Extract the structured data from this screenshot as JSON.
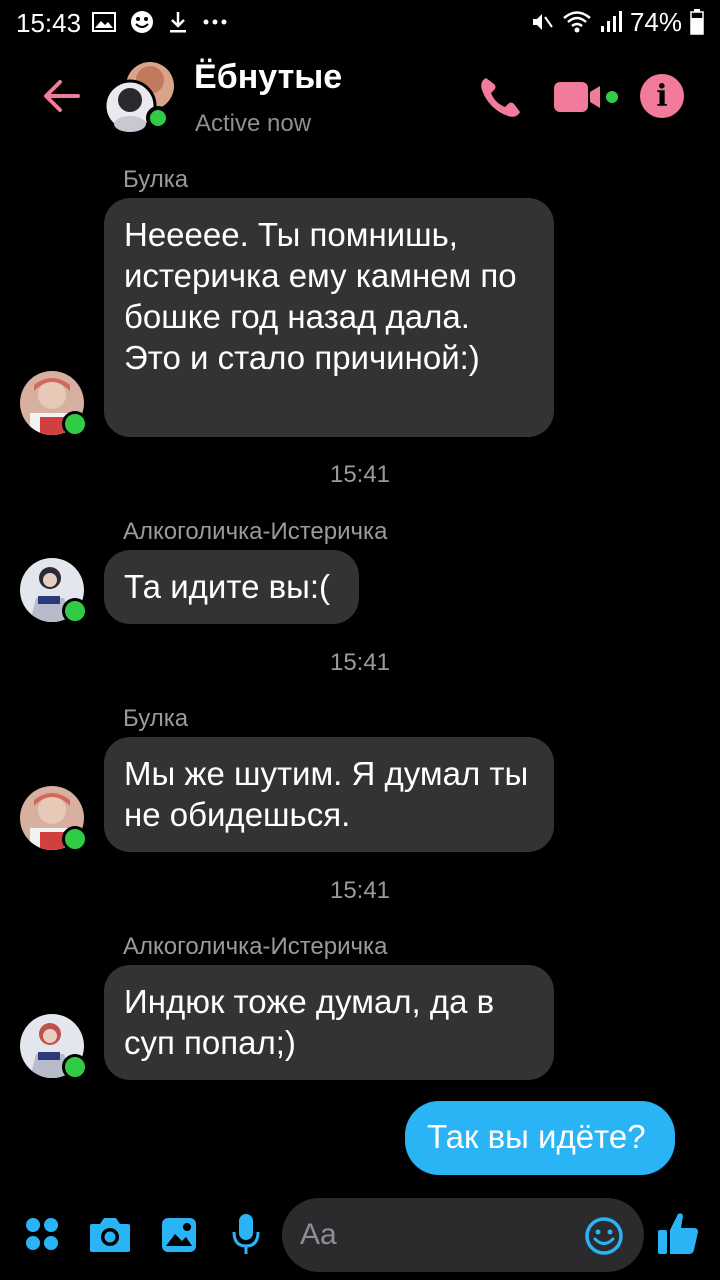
{
  "status_bar": {
    "time": "15:43",
    "battery": "74%",
    "icons_left": [
      "gallery-icon",
      "smiley-icon",
      "download-icon",
      "more-icon"
    ],
    "icons_right": [
      "mute-icon",
      "wifi-icon",
      "signal-icon",
      "battery-icon"
    ]
  },
  "header": {
    "title": "Ёбнутые",
    "subtitle": "Active now",
    "accent_color": "#f27a9a",
    "online_color": "#31cc46"
  },
  "messages": [
    {
      "sender": "Булка",
      "text": "Неееее. Ты помнишь, истеричка ему камнем по бошке год назад дала. Это и стало причиной:)"
    },
    {
      "timestamp": "15:41"
    },
    {
      "sender": "Алкоголичка-Истеричка",
      "text": "Та идите вы:("
    },
    {
      "timestamp": "15:41"
    },
    {
      "sender": "Булка",
      "text": "Мы же шутим. Я думал ты не обидешься."
    },
    {
      "timestamp": "15:41"
    },
    {
      "sender": "Алкоголичка-Истеричка",
      "text": "Индюк тоже думал, да в суп попал;)"
    },
    {
      "own_text": "Так вы идёте?"
    }
  ],
  "composer": {
    "placeholder": "Aa",
    "tools": [
      "apps-icon",
      "camera-icon",
      "gallery-icon",
      "microphone-icon"
    ],
    "accent_color": "#2ab4f5"
  }
}
